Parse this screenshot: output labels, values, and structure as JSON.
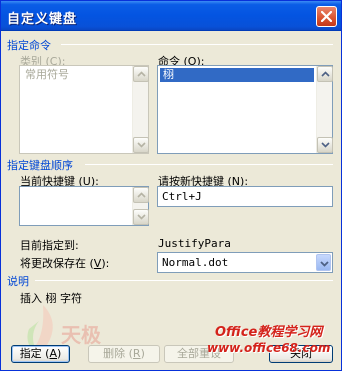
{
  "window": {
    "title": "自定义键盘"
  },
  "sections": {
    "specify_command": "指定命令",
    "specify_shortcut": "指定键盘顺序",
    "description": "说明"
  },
  "category": {
    "label_prefix": "类别 (",
    "label_key": "C",
    "label_suffix": "):",
    "items": [
      "常用符号"
    ]
  },
  "command": {
    "label_prefix": "命令 (",
    "label_key": "O",
    "label_suffix": "):",
    "items": [
      "  栩"
    ]
  },
  "current_keys": {
    "label_prefix": "当前快捷键 (",
    "label_key": "U",
    "label_suffix": "):"
  },
  "new_key": {
    "label_prefix": "请按新快捷键 (",
    "label_key": "N",
    "label_suffix": "):",
    "value": "Ctrl+J"
  },
  "currently_assigned": {
    "label": "目前指定到:",
    "value": "JustifyPara"
  },
  "save_in": {
    "label_prefix": "将更改保存在 (",
    "label_key": "V",
    "label_suffix": "):",
    "value": "Normal.dot"
  },
  "description_text": "插入 栩 字符",
  "buttons": {
    "assign": {
      "prefix": "指定 (",
      "key": "A",
      "suffix": ")"
    },
    "remove": {
      "prefix": "删除 (",
      "key": "R",
      "suffix": ")"
    },
    "reset_all": "全部重设",
    "close": "关闭"
  },
  "watermark": {
    "brand": "天极",
    "site": "Office教程学习网",
    "url": "www.office68.com"
  },
  "colors": {
    "titlebar": "#0454e1",
    "section_label": "#0046d5",
    "selection": "#316ac5",
    "watermark_red": "#d4231b"
  }
}
